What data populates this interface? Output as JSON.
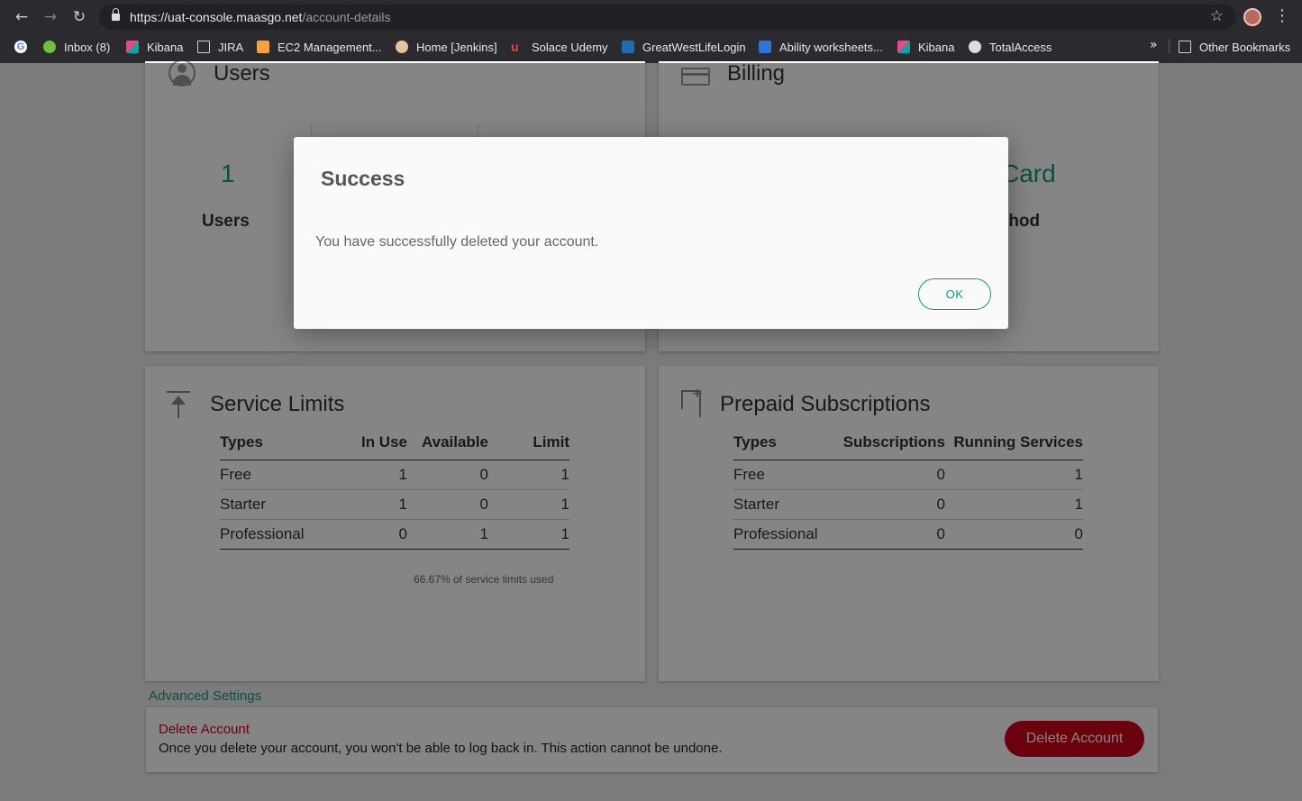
{
  "browser": {
    "url_host": "https://uat-console.maasgo.net",
    "url_path": "/account-details",
    "bookmarks": [
      {
        "label": "",
        "icon": "google-icon"
      },
      {
        "label": "Inbox (8)",
        "icon": "inbox-icon"
      },
      {
        "label": "Kibana",
        "icon": "kibana-icon"
      },
      {
        "label": "JIRA",
        "icon": "folder-icon"
      },
      {
        "label": "EC2 Management...",
        "icon": "aws-icon"
      },
      {
        "label": "Home [Jenkins]",
        "icon": "jenkins-icon"
      },
      {
        "label": "Solace Udemy",
        "icon": "udemy-icon"
      },
      {
        "label": "GreatWestLifeLogin",
        "icon": "key-icon"
      },
      {
        "label": "Ability worksheets...",
        "icon": "worksheet-icon"
      },
      {
        "label": "Kibana",
        "icon": "kibana-icon"
      },
      {
        "label": "TotalAccess",
        "icon": "globe-icon"
      }
    ],
    "more_label": "»",
    "other_bookmarks": "Other Bookmarks"
  },
  "users_card": {
    "title": "Users",
    "metric_value": "1",
    "metric_label": "Users"
  },
  "billing_card": {
    "title": "Billing",
    "metric_value_partial": "Card",
    "metric_label_partial": "thod"
  },
  "service_limits": {
    "title": "Service Limits",
    "columns": [
      "Types",
      "In Use",
      "Available",
      "Limit"
    ],
    "rows": [
      [
        "Free",
        "1",
        "0",
        "1"
      ],
      [
        "Starter",
        "1",
        "0",
        "1"
      ],
      [
        "Professional",
        "0",
        "1",
        "1"
      ]
    ],
    "usage_note": "66.67% of service limits used"
  },
  "prepaid_subscriptions": {
    "title": "Prepaid Subscriptions",
    "columns": [
      "Types",
      "Subscriptions",
      "Running Services"
    ],
    "rows": [
      [
        "Free",
        "0",
        "1"
      ],
      [
        "Starter",
        "0",
        "1"
      ],
      [
        "Professional",
        "0",
        "0"
      ]
    ]
  },
  "advanced": {
    "link_label": "Advanced Settings",
    "danger_title": "Delete Account",
    "danger_text": "Once you delete your account, you won't be able to log back in. This action cannot be undone.",
    "delete_button": "Delete Account"
  },
  "modal": {
    "title": "Success",
    "message": "You have successfully deleted your account.",
    "ok_label": "OK"
  },
  "colors": {
    "accent": "#159a82",
    "danger": "#d0021b"
  }
}
